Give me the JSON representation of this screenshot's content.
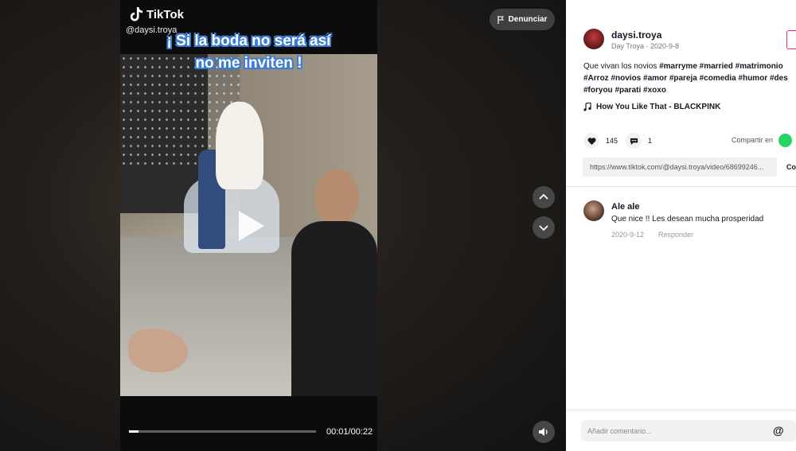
{
  "video": {
    "brand": "TikTok",
    "handle": "@daysi.troya",
    "caption_line1": "¡ Si la boda no será así",
    "caption_line2": "no me inviten !",
    "time": "00:01/00:22",
    "progress": 0.05,
    "report_label": "Denunciar"
  },
  "post": {
    "username": "daysi.troya",
    "meta": "Day Troya · 2020-9-8",
    "desc_line1_prefix": "Que vivan los novios ",
    "desc_line1_tags": "#marryme #married #matrimonio",
    "desc_line2": "#Arroz #novios #amor #pareja #comedia #humor #des",
    "desc_line3": "#foryou #parati #xoxo",
    "music": "How You Like That - BLACKPINK",
    "likes": "145",
    "comments": "1",
    "share_label": "Compartir en",
    "link": "https://www.tiktok.com/@daysi.troya/video/68699246...",
    "copy_label": "Co"
  },
  "comment": {
    "author": "Ale ale",
    "text": "Que nice !! Les desean mucha prosperidad",
    "date": "2020-9-12",
    "reply_label": "Responder"
  },
  "input": {
    "placeholder": "Añadir comentario..."
  }
}
